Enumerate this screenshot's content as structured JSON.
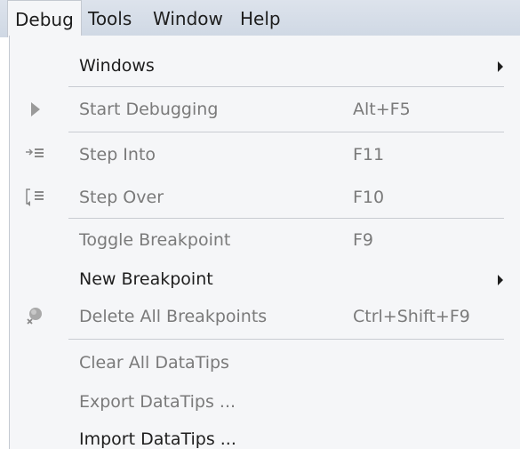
{
  "menubar": {
    "items": [
      "Debug",
      "Tools",
      "Window",
      "Help"
    ]
  },
  "dropdown": {
    "items": [
      {
        "label": "Windows",
        "shortcut": "",
        "submenu": true,
        "enabled": true,
        "icon": ""
      },
      {
        "label": "Start Debugging",
        "shortcut": "Alt+F5",
        "submenu": false,
        "enabled": false,
        "icon": "play-icon"
      },
      {
        "label": "Step Into",
        "shortcut": "F11",
        "submenu": false,
        "enabled": false,
        "icon": "step-into-icon"
      },
      {
        "label": "Step Over",
        "shortcut": "F10",
        "submenu": false,
        "enabled": false,
        "icon": "step-over-icon"
      },
      {
        "label": "Toggle Breakpoint",
        "shortcut": "F9",
        "submenu": false,
        "enabled": false,
        "icon": ""
      },
      {
        "label": "New Breakpoint",
        "shortcut": "",
        "submenu": true,
        "enabled": true,
        "icon": ""
      },
      {
        "label": "Delete All Breakpoints",
        "shortcut": "Ctrl+Shift+F9",
        "submenu": false,
        "enabled": false,
        "icon": "delete-breakpoints-icon"
      },
      {
        "label": "Clear All DataTips",
        "shortcut": "",
        "submenu": false,
        "enabled": false,
        "icon": ""
      },
      {
        "label": "Export DataTips ...",
        "shortcut": "",
        "submenu": false,
        "enabled": false,
        "icon": ""
      },
      {
        "label": "Import DataTips ...",
        "shortcut": "",
        "submenu": false,
        "enabled": true,
        "icon": ""
      }
    ]
  },
  "colors": {
    "menubar_bg": "#d3dbe6",
    "menu_bg": "#f5f6f8",
    "text": "#1e1e1e",
    "disabled_text": "#7a7a7a",
    "separator": "#c9ccd2"
  }
}
